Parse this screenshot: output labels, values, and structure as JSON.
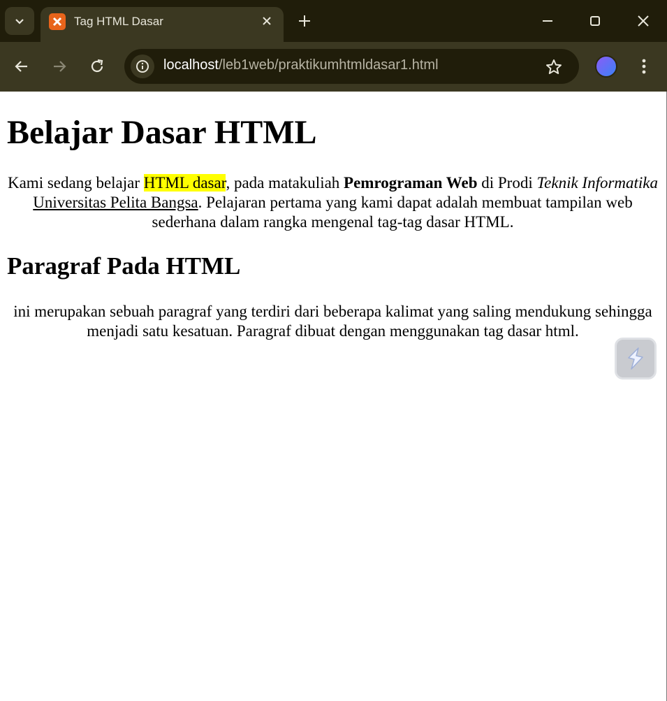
{
  "window": {
    "tab_title": "Tag HTML Dasar",
    "favicon_glyph": "⌘",
    "new_tab": "+",
    "close_tab": "✕"
  },
  "toolbar": {
    "url_host": "localhost",
    "url_path": "/leb1web/praktikumhtmldasar1.html"
  },
  "page": {
    "h1": "Belajar Dasar HTML",
    "p1": {
      "t1": "Kami sedang belajar ",
      "mark": "HTML dasar",
      "t2": ", pada matakuliah ",
      "bold": "Pemrograman Web",
      "t3": " di Prodi ",
      "italic": "Teknik Informatika",
      "t4": " ",
      "underline": "Universitas Pelita Bangsa",
      "t5": ". Pelajaran pertama yang kami dapat adalah membuat tampilan web sederhana dalam rangka mengenal tag-tag dasar HTML."
    },
    "h2": "Paragraf Pada HTML",
    "p2": "ini merupakan sebuah paragraf yang terdiri dari beberapa kalimat yang saling mendukung sehingga menjadi satu kesatuan. Paragraf dibuat dengan menggunakan tag dasar html."
  },
  "colors": {
    "highlight": "#ffff00",
    "chrome_bg": "#3b3821",
    "tabbar_bg": "#201d0a"
  }
}
